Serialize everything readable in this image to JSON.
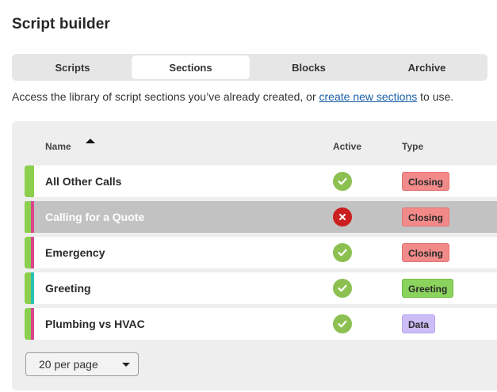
{
  "page": {
    "title": "Script builder"
  },
  "tabs": [
    {
      "label": "Scripts",
      "active": false
    },
    {
      "label": "Sections",
      "active": true
    },
    {
      "label": "Blocks",
      "active": false
    },
    {
      "label": "Archive",
      "active": false
    }
  ],
  "intro": {
    "before": "Access the library of script sections you’ve already created, or ",
    "link": "create new sections",
    "after": " to use."
  },
  "table": {
    "columns": {
      "name": "Name",
      "active": "Active",
      "type": "Type"
    },
    "sort": {
      "column": "Name",
      "direction": "ascending"
    },
    "rows": [
      {
        "name": "All Other Calls",
        "active": true,
        "type": "Closing",
        "accent": "#8ccf4d",
        "selected": false
      },
      {
        "name": "Calling for a Quote",
        "active": false,
        "type": "Closing",
        "accent": "#d9468e",
        "selected": true
      },
      {
        "name": "Emergency",
        "active": true,
        "type": "Closing",
        "accent": "#d9468e",
        "selected": false
      },
      {
        "name": "Greeting",
        "active": true,
        "type": "Greeting",
        "accent": "#2ec0b4",
        "selected": false
      },
      {
        "name": "Plumbing vs HVAC",
        "active": true,
        "type": "Data",
        "accent": "#d9468e",
        "selected": false
      }
    ]
  },
  "pagination": {
    "per_page": "20 per page"
  },
  "colors": {
    "closing_badge": "#f38a8a",
    "greeting_badge": "#8ad45e",
    "data_badge": "#cdbdf7",
    "active_ok": "#8cc152",
    "active_no": "#cc1f1f",
    "link": "#1a5fa8"
  },
  "icons": {
    "active": "check-icon",
    "inactive": "x-icon",
    "sort": "sort-ascending-icon",
    "dropdown": "chevron-down-icon"
  }
}
